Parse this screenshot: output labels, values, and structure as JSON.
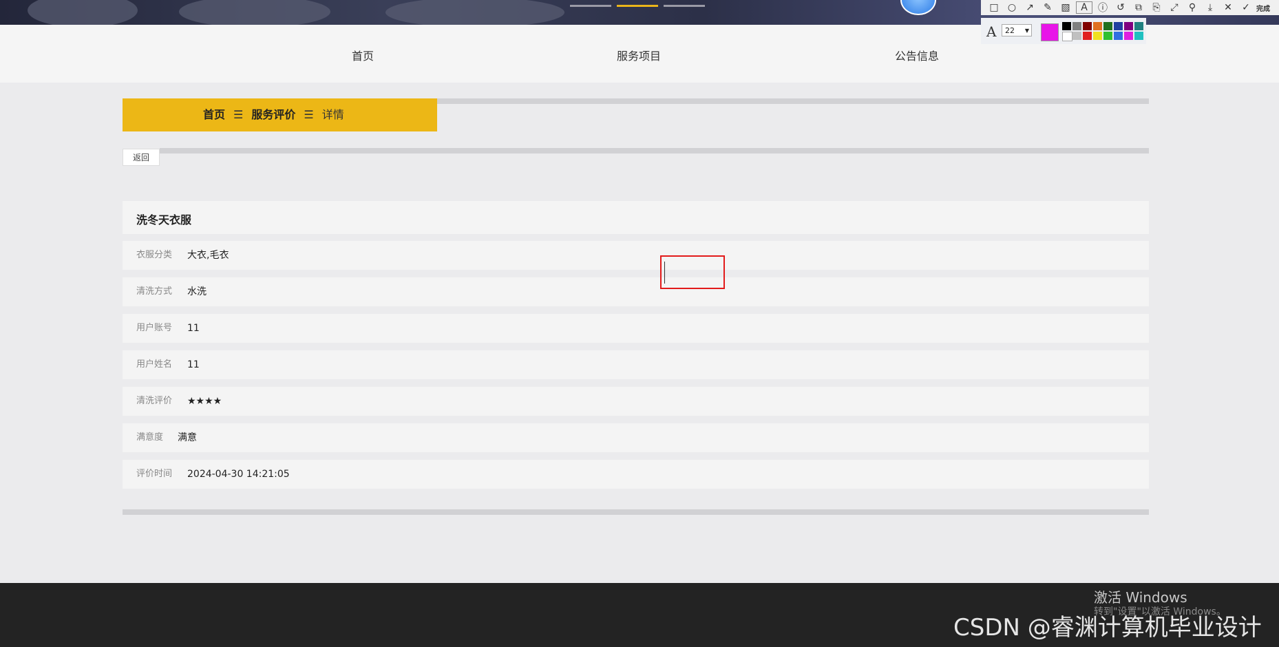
{
  "nav": {
    "items": [
      {
        "label": "首页"
      },
      {
        "label": "服务项目"
      },
      {
        "label": "公告信息"
      }
    ]
  },
  "tool": {
    "font_size": "22",
    "done_label": "完成",
    "current_color": "#e815e8",
    "palette": [
      "#000000",
      "#808080",
      "#800000",
      "#e07020",
      "#207020",
      "#2040a0",
      "#800080",
      "#208080",
      "#ffffff",
      "#c0c0c0",
      "#e02020",
      "#f0e020",
      "#30c030",
      "#3070e0",
      "#e020e0",
      "#20c0c0"
    ]
  },
  "breadcrumb": {
    "home": "首页",
    "section": "服务评价",
    "current": "详情",
    "separator": "☰"
  },
  "back_label": "返回",
  "detail": {
    "title": "洗冬天衣服",
    "fields": [
      {
        "label": "衣服分类",
        "value": "大衣,毛衣"
      },
      {
        "label": "清洗方式",
        "value": "水洗"
      },
      {
        "label": "用户账号",
        "value": "11"
      },
      {
        "label": "用户姓名",
        "value": "11"
      },
      {
        "label": "清洗评价",
        "value": "★★★★"
      },
      {
        "label": "满意度",
        "value": "满意"
      },
      {
        "label": "评价时间",
        "value": "2024-04-30 14:21:05"
      }
    ]
  },
  "watermark": {
    "activate_title": "激活 Windows",
    "activate_sub": "转到\"设置\"以激活 Windows。",
    "csdn": "CSDN @睿渊计算机毕业设计"
  }
}
